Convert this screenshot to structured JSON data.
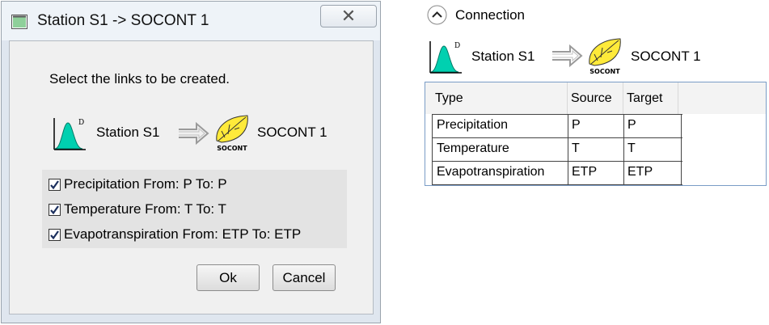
{
  "dialog": {
    "title": "Station S1 -> SOCONT 1",
    "close_symbol": "✕",
    "instruction": "Select the links to be created.",
    "source_label": "Station S1",
    "target_label": "SOCONT 1",
    "target_icon_text": "SOCONT",
    "source_icon_sup": "D",
    "links": [
      {
        "text": "Precipitation  From: P  To: P",
        "checked": true
      },
      {
        "text": "Temperature  From: T  To: T",
        "checked": true
      },
      {
        "text": "Evapotranspiration  From: ETP  To: ETP",
        "checked": true
      }
    ],
    "ok_label": "Ok",
    "cancel_label": "Cancel"
  },
  "connection": {
    "label": "Connection",
    "source_label": "Station S1",
    "target_label": "SOCONT 1",
    "target_icon_text": "SOCONT",
    "source_icon_sup": "D",
    "columns": [
      "Type",
      "Source",
      "Target"
    ],
    "rows": [
      [
        "Precipitation",
        "P",
        "P"
      ],
      [
        "Temperature",
        "T",
        "T"
      ],
      [
        "Evapotranspiration",
        "ETP",
        "ETP"
      ]
    ]
  },
  "colors": {
    "curve_fill": "#00d0b0",
    "leaf_fill": "#ffea3a",
    "link_border": "#7a9cc6"
  },
  "icons": [
    "app-window-icon",
    "close-icon",
    "station-hydrograph-icon",
    "double-arrow-icon",
    "socont-leaf-icon",
    "checkmark-icon",
    "collapse-chevron-icon"
  ]
}
